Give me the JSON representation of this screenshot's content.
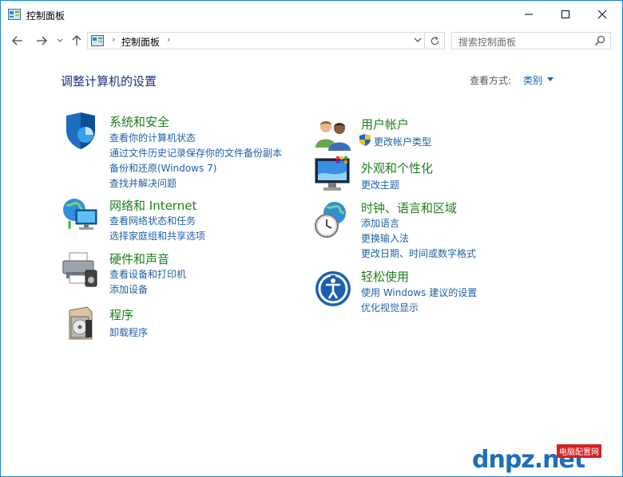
{
  "window": {
    "title": "控制面板",
    "controls": {
      "minimize": "minimize-icon",
      "maximize": "maximize-icon",
      "close": "close-icon"
    }
  },
  "address": {
    "path": "控制面板",
    "search_placeholder": "搜索控制面板"
  },
  "content": {
    "heading": "调整计算机的设置",
    "view_by_label": "查看方式:",
    "view_by_value": "类别"
  },
  "categories": [
    {
      "title": "系统和安全",
      "icon": "shield-icon",
      "links": [
        "查看你的计算机状态",
        "通过文件历史记录保存你的文件备份副本",
        "备份和还原(Windows 7)",
        "查找并解决问题"
      ]
    },
    {
      "title": "网络和 Internet",
      "icon": "network-globe-icon",
      "links": [
        "查看网络状态和任务",
        "选择家庭组和共享选项"
      ]
    },
    {
      "title": "硬件和声音",
      "icon": "printer-icon",
      "links": [
        "查看设备和打印机",
        "添加设备"
      ]
    },
    {
      "title": "程序",
      "icon": "programs-icon",
      "links": [
        "卸载程序"
      ]
    },
    {
      "title": "用户帐户",
      "icon": "users-icon",
      "links": [
        "更改帐户类型"
      ]
    },
    {
      "title": "外观和个性化",
      "icon": "monitor-icon",
      "links": [
        "更改主题"
      ]
    },
    {
      "title": "时钟、语言和区域",
      "icon": "clock-globe-icon",
      "links": [
        "添加语言",
        "更换输入法",
        "更改日期、时间或数字格式"
      ]
    },
    {
      "title": "轻松使用",
      "icon": "ease-of-access-icon",
      "links": [
        "使用 Windows 建议的设置",
        "优化视觉显示"
      ]
    }
  ],
  "watermark": {
    "text": "dnpz.net",
    "badge": "电脑配置网"
  },
  "colors": {
    "border": "#1883d7",
    "heading": "#1e3287",
    "category": "#1f7f1f",
    "link": "#1f5fa8"
  }
}
